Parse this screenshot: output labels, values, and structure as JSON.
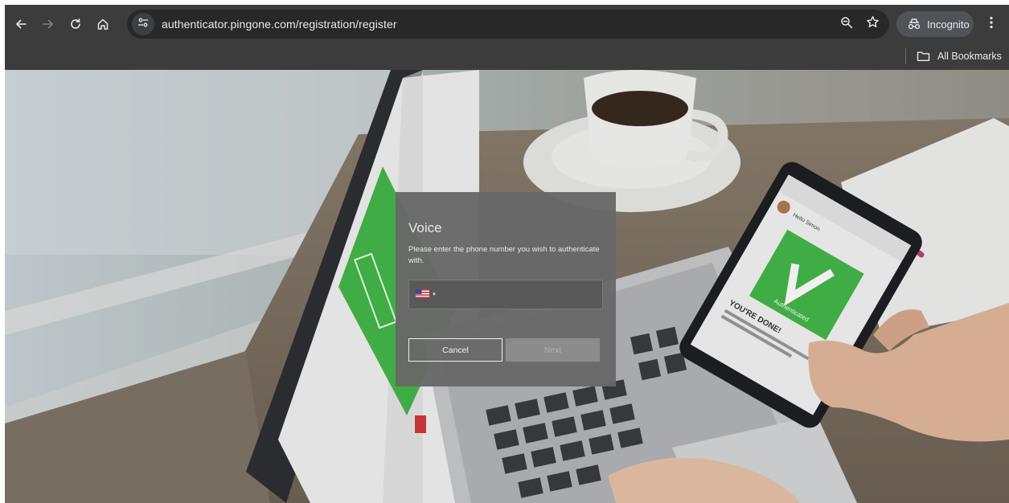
{
  "browser": {
    "url": "authenticator.pingone.com/registration/register",
    "profile_label": "Incognito",
    "bookmarks_folder_label": "All Bookmarks",
    "icons": [
      "back-icon",
      "forward-icon",
      "reload-icon",
      "home-icon",
      "site-info-icon",
      "zoom-icon",
      "bookmark-star-icon",
      "incognito-icon",
      "more-menu-icon",
      "folder-icon"
    ]
  },
  "dialog": {
    "title": "Voice",
    "description": "Please enter the phone number you wish to authenticate with.",
    "phone": {
      "value": "",
      "placeholder": "",
      "country_flag": "us-flag-icon"
    },
    "cancel_label": "Cancel",
    "next_label": "Next",
    "next_enabled": false
  },
  "background_phone_screen": {
    "hello_text": "Hello Simon",
    "status_text": "Authenticated",
    "done_text": "YOU'RE DONE!"
  },
  "colors": {
    "chrome_bg": "#3c3c3c",
    "omnibox_bg": "#282828",
    "dialog_bg": "#686868",
    "accent_green": "#45b74a"
  }
}
